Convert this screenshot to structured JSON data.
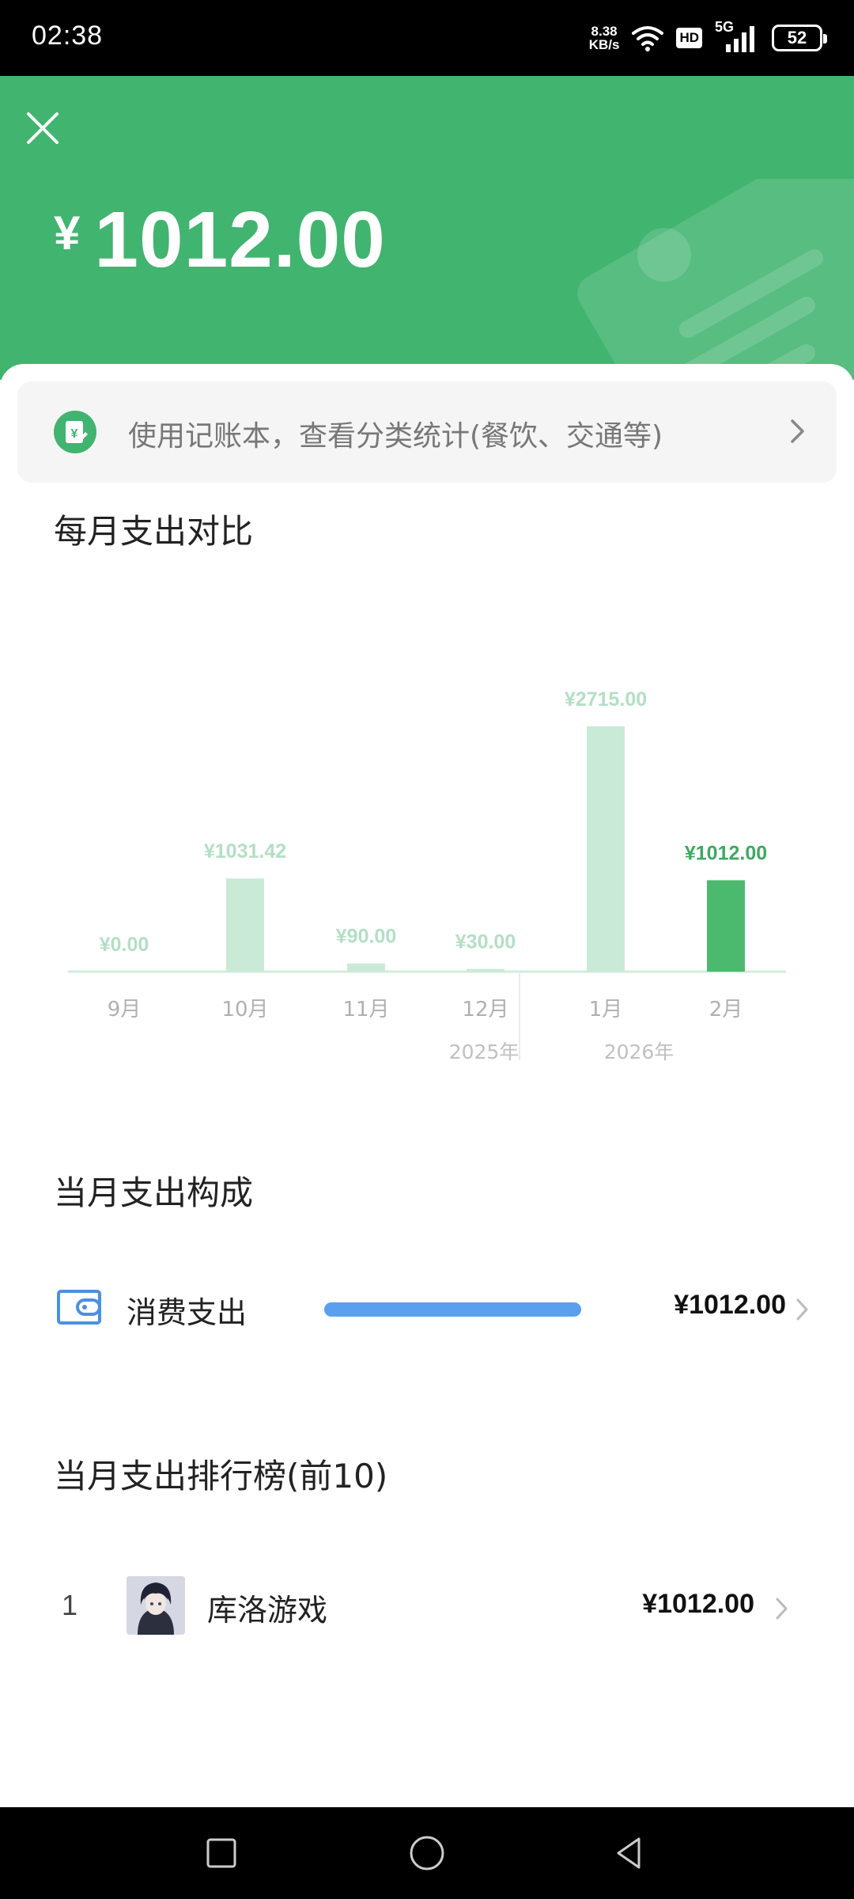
{
  "status_bar": {
    "time": "02:38",
    "net_speed_value": "8.38",
    "net_speed_unit": "KB/s",
    "hd_label": "HD",
    "network_label": "5G",
    "battery_level": "52",
    "icons": [
      "wifi-icon",
      "hd-icon",
      "signal-icon",
      "battery-icon"
    ]
  },
  "header": {
    "close_icon": "close-icon",
    "currency_symbol": "¥",
    "total_amount": "1012.00",
    "background_color": "#41b46f"
  },
  "ledger_banner": {
    "icon": "ledger-yen-icon",
    "text": "使用记账本，查看分类统计(餐饮、交通等)",
    "chevron_icon": "chevron-right-icon"
  },
  "monthly_section": {
    "title": "每月支出对比"
  },
  "chart_data": {
    "type": "bar",
    "categories": [
      "9月",
      "10月",
      "11月",
      "12月",
      "1月",
      "2月"
    ],
    "values": [
      0.0,
      1031.42,
      90.0,
      30.0,
      2715.0,
      1012.0
    ],
    "value_labels": [
      "¥0.00",
      "¥1031.42",
      "¥90.00",
      "¥30.00",
      "¥2715.00",
      "¥1012.00"
    ],
    "year_labels": [
      "2025年",
      "2026年"
    ],
    "highlight_index": 5,
    "bar_color": "#c9ead6",
    "highlight_color": "#4cba6e",
    "label_color": "#b3dfc4",
    "highlight_label_color": "#3fa862"
  },
  "composition_section": {
    "title": "当月支出构成",
    "items": [
      {
        "icon": "wallet-icon",
        "label": "消费支出",
        "amount": "¥1012.00",
        "share": 1.0,
        "bar_color": "#5aa0ef"
      }
    ]
  },
  "ranking_section": {
    "title": "当月支出排行榜(前10)",
    "items": [
      {
        "rank": "1",
        "avatar": "merchant-avatar",
        "name": "库洛游戏",
        "amount": "¥1012.00"
      }
    ]
  },
  "nav_bar": {
    "icons": [
      "recents-square-icon",
      "home-circle-icon",
      "back-triangle-icon"
    ]
  }
}
